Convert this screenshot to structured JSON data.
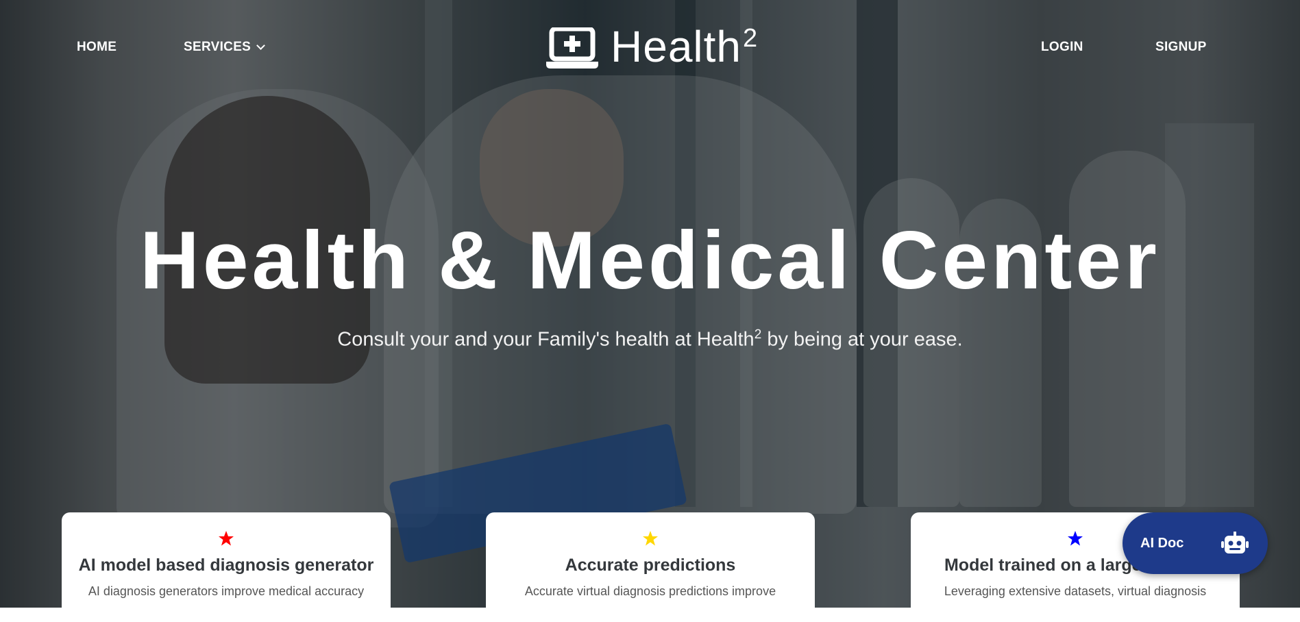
{
  "nav": {
    "home": "HOME",
    "services": "SERVICES",
    "login": "LOGIN",
    "signup": "SIGNUP"
  },
  "logo": {
    "text": "Health",
    "sup": "2",
    "icon": "laptop-medical-icon"
  },
  "hero": {
    "title": "Health & Medical Center",
    "subtitle_before": "Consult your and your Family's health at Health",
    "subtitle_sup": "2",
    "subtitle_after": " by being at your ease."
  },
  "cards": [
    {
      "star_color": "#ff0000",
      "title": "AI model based diagnosis generator",
      "text": "AI diagnosis generators improve medical accuracy"
    },
    {
      "star_color": "#ffd700",
      "title": "Accurate predictions",
      "text": "Accurate virtual diagnosis predictions improve"
    },
    {
      "star_color": "#0000ff",
      "title": "Model trained on a large dataset",
      "text": "Leveraging extensive datasets, virtual diagnosis"
    }
  ],
  "ai_doc": {
    "label": "AI Doc",
    "icon": "robot-icon",
    "color": "#1e3a8a"
  }
}
